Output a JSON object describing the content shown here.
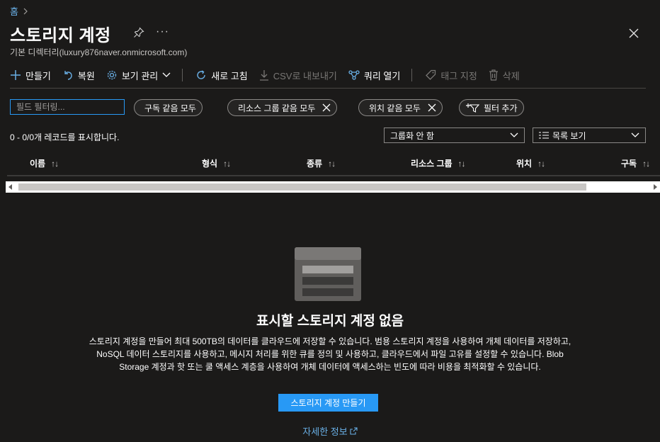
{
  "breadcrumb": {
    "home": "홈"
  },
  "header": {
    "title": "스토리지 계정",
    "subtitle": "기본 디렉터리(luxury876naver.onmicrosoft.com)",
    "more_label": "···"
  },
  "toolbar": {
    "create": "만들기",
    "restore": "복원",
    "manage_view": "보기 관리",
    "refresh": "새로 고침",
    "export_csv": "CSV로 내보내기",
    "open_query": "쿼리 열기",
    "assign_tags": "태그 지정",
    "delete": "삭제"
  },
  "filters": {
    "search_placeholder": "필드 필터링...",
    "subscription": "구독 같음 모두",
    "resource_group": "리소스 그룹 같음 모두",
    "location": "위치 같음 모두",
    "add_filter": "필터 추가"
  },
  "records": {
    "count_text": "0 - 0/0개 레코드를 표시합니다.",
    "grouping": "그룹화 안 함",
    "view": "목록 보기"
  },
  "table": {
    "columns": [
      {
        "label": "이름",
        "sort": "↑↓"
      },
      {
        "label": "형식",
        "sort": "↑↓"
      },
      {
        "label": "종류",
        "sort": "↑↓"
      },
      {
        "label": "리소스 그룹",
        "sort": "↑↓"
      },
      {
        "label": "위치",
        "sort": "↑↓"
      },
      {
        "label": "구독",
        "sort": "↑↓"
      }
    ]
  },
  "empty": {
    "title": "표시할 스토리지 계정 없음",
    "description": "스토리지 계정을 만들어 최대 500TB의 데이터를 클라우드에 저장할 수 있습니다. 범용 스토리지 계정을 사용하여 개체 데이터를 저장하고, NoSQL 데이터 스토리지를 사용하고, 메시지 처리를 위한 큐를 정의 및 사용하고, 클라우드에서 파일 고유를 설정할 수 있습니다. Blob Storage 계정과 핫 또는 쿨 액세스 계층을 사용하여 개체 데이터에 액세스하는 빈도에 따라 비용을 최적화할 수 있습니다.",
    "create_button": "스토리지 계정 만들기",
    "learn_more": "자세한 정보"
  },
  "colors": {
    "background": "#1b1a19",
    "accent": "#2899f5",
    "link": "#69afe5",
    "disabled": "#797775"
  }
}
